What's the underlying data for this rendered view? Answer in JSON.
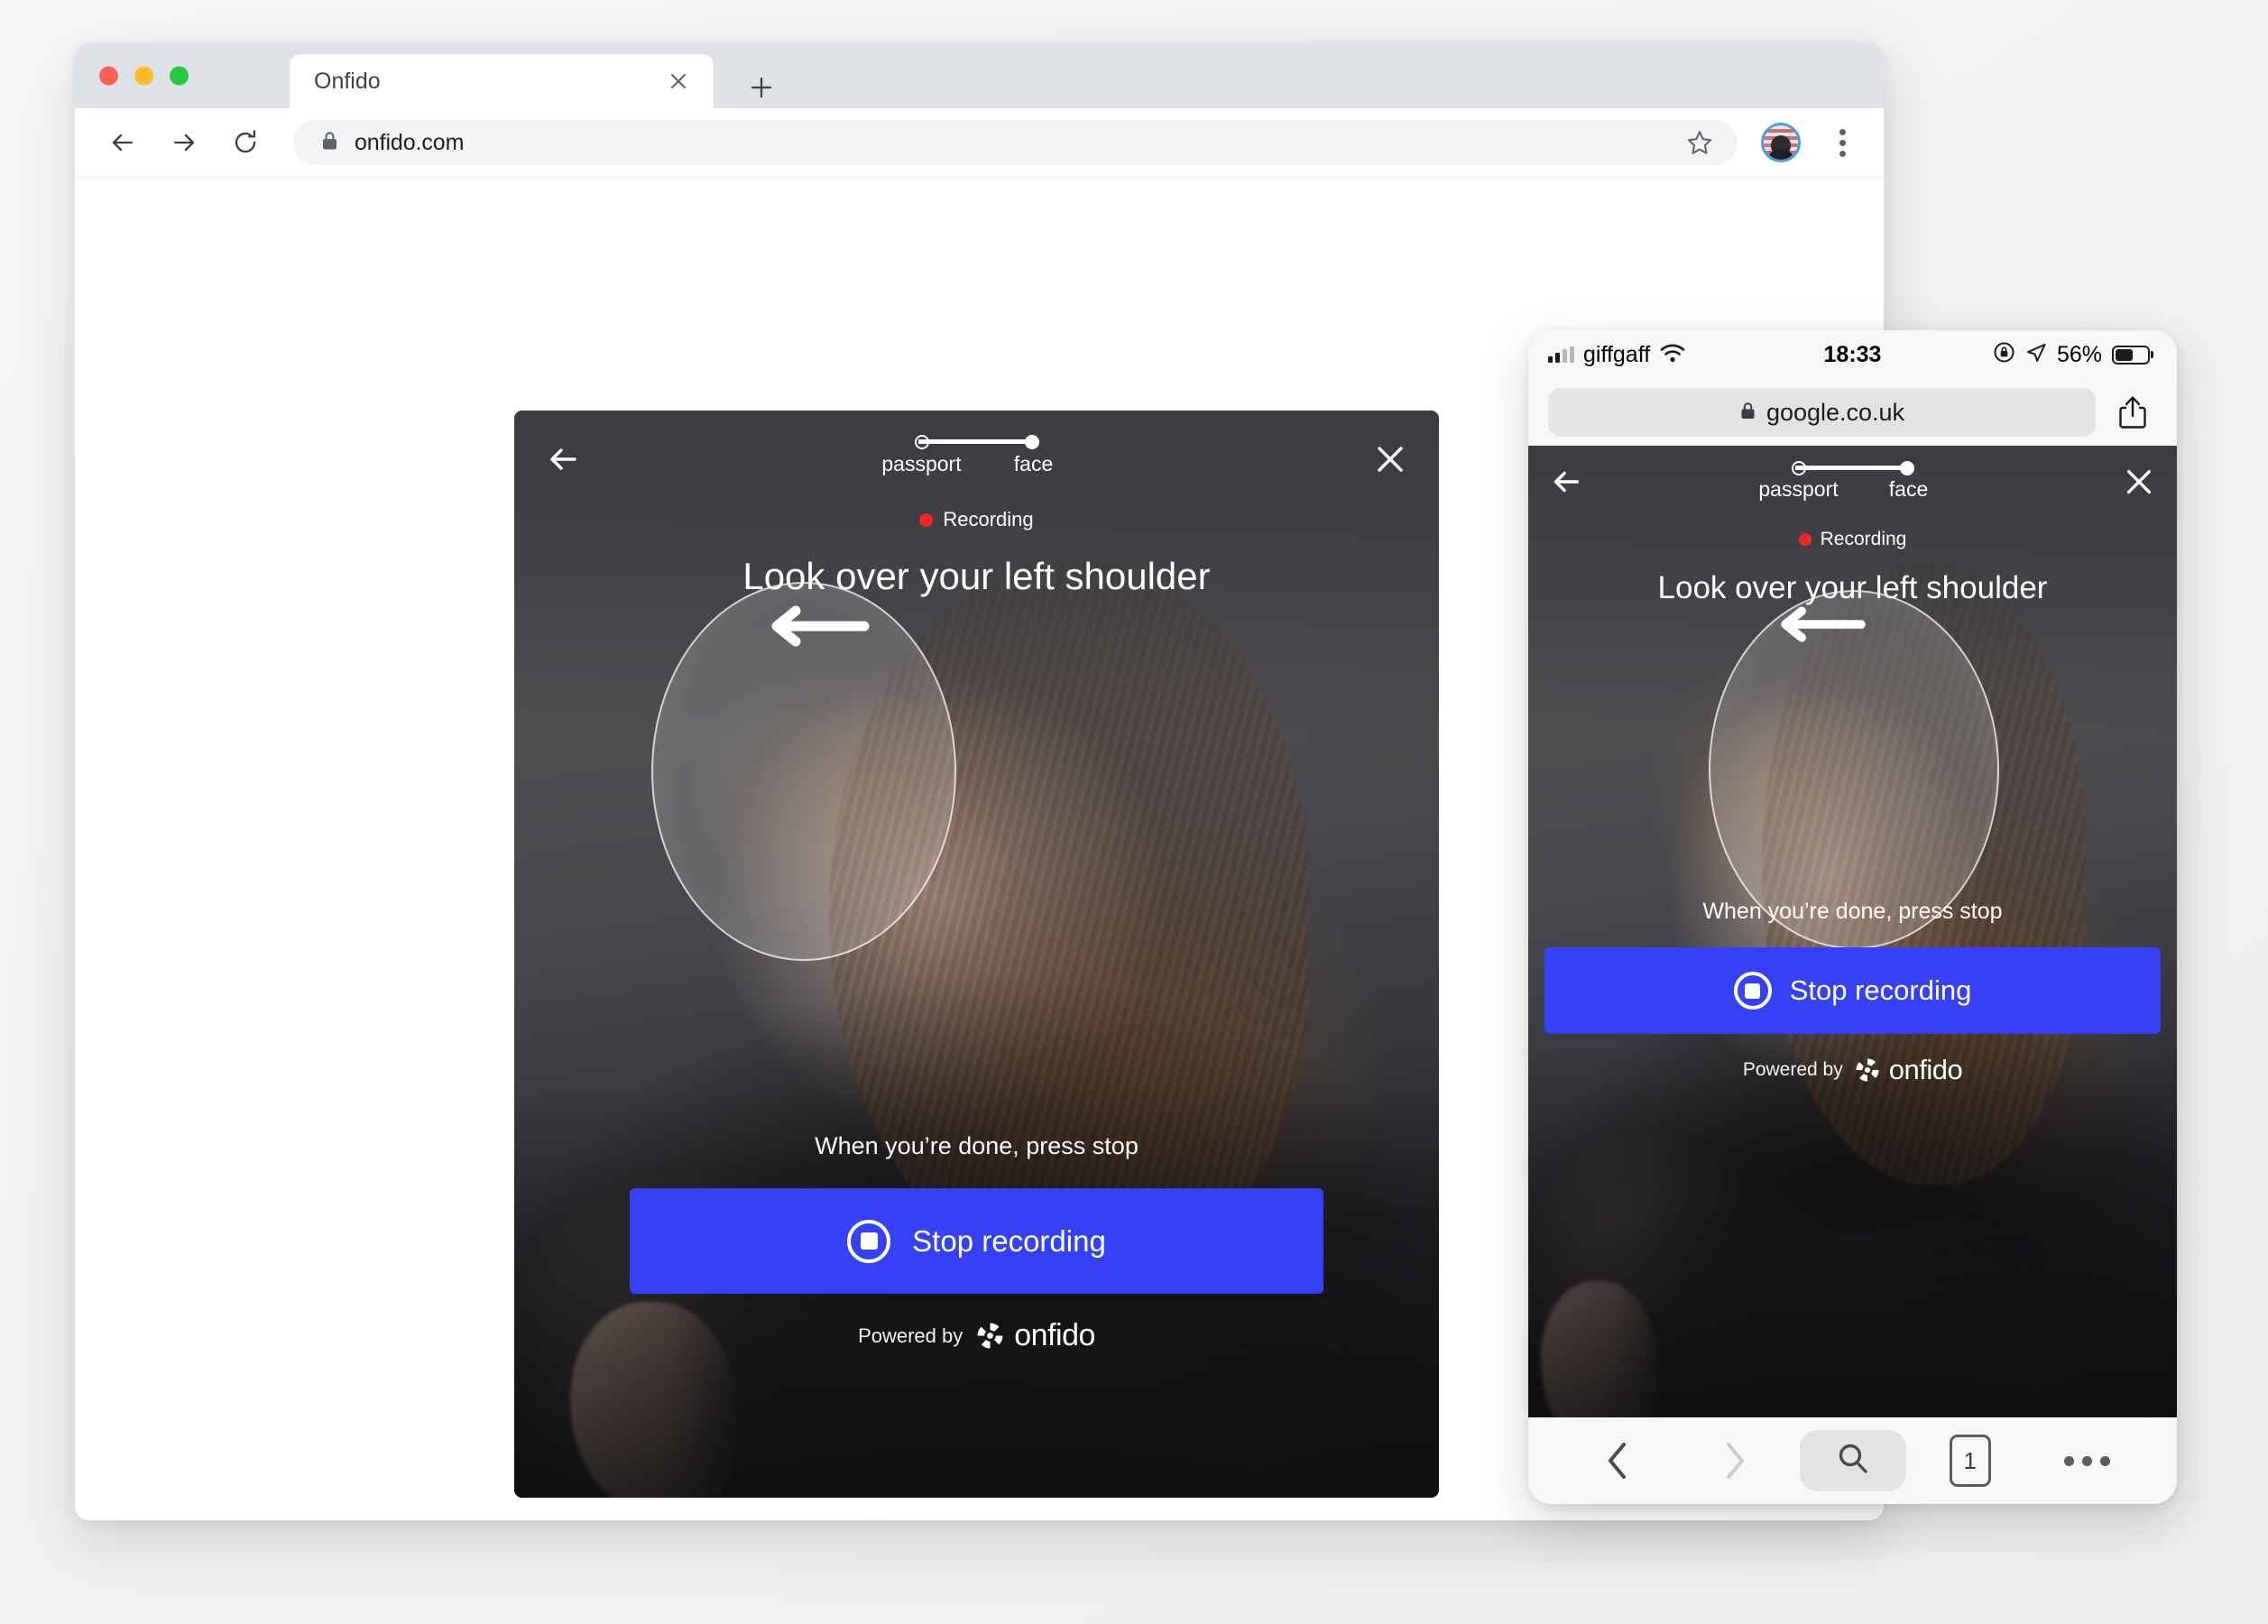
{
  "desktop_browser": {
    "tab": {
      "title": "Onfido",
      "close_icon": "close-icon"
    },
    "new_tab_icon": "plus-icon",
    "back_icon": "arrow-left-icon",
    "forward_icon": "arrow-right-icon",
    "reload_icon": "reload-icon",
    "omnibox": {
      "url": "onfido.com",
      "lock_icon": "lock-icon"
    },
    "star_icon": "star-icon",
    "avatar": "profile-avatar",
    "menu_icon": "kebab-menu-icon"
  },
  "onfido": {
    "back_icon": "arrow-left-icon",
    "close_icon": "close-x-icon",
    "steps": [
      {
        "label": "passport",
        "state": "done"
      },
      {
        "label": "face",
        "state": "current"
      }
    ],
    "recording_label": "Recording",
    "recording_dot_color": "#e8282b",
    "headline": "Look over your left shoulder",
    "turn_arrow_icon": "arrow-left-long-icon",
    "hint": "When you’re done, press stop",
    "stop_button": {
      "label": "Stop recording",
      "icon": "stop-record-icon",
      "color": "#3640f5"
    },
    "footer": {
      "powered_by": "Powered by",
      "brand": "onfido",
      "brand_mark": "onfido-logo-icon"
    }
  },
  "phone": {
    "status_bar": {
      "carrier": "giffgaff",
      "signal_icon": "signal-bars-icon",
      "wifi_icon": "wifi-icon",
      "time": "18:33",
      "rotation_lock_icon": "rotation-lock-icon",
      "location_icon": "location-arrow-icon",
      "battery_percent": "56%",
      "battery_icon": "battery-icon"
    },
    "url_bar": {
      "url": "google.co.uk",
      "lock_icon": "lock-icon",
      "share_icon": "share-icon"
    },
    "toolbar": {
      "back_icon": "chevron-left-icon",
      "forward_icon": "chevron-right-icon",
      "search_icon": "search-icon",
      "tabs_count": "1",
      "more_icon": "ellipsis-icon"
    }
  }
}
